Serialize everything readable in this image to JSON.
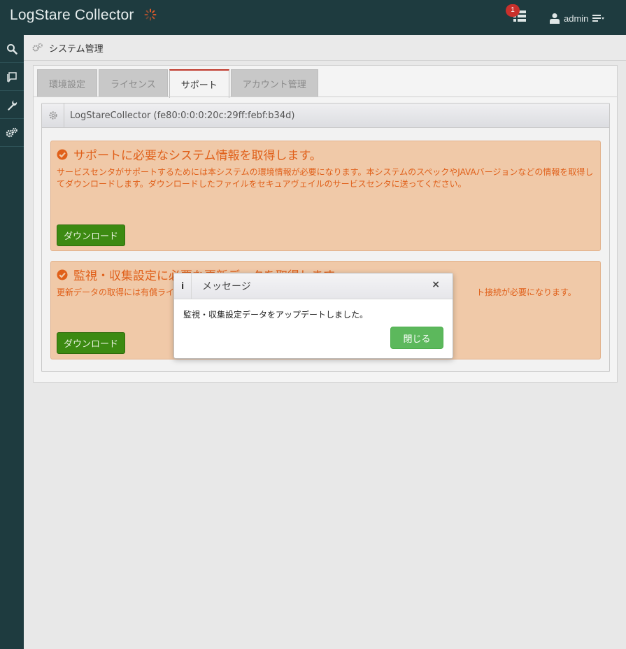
{
  "header": {
    "app_title": "LogStare Collector",
    "task_count": "1",
    "user_name": "admin"
  },
  "sidebar": {
    "items": [
      {
        "name": "search-icon"
      },
      {
        "name": "book-icon"
      },
      {
        "name": "wrench-icon"
      },
      {
        "name": "gears-icon"
      }
    ]
  },
  "breadcrumb": {
    "label": "システム管理"
  },
  "tabs": [
    {
      "label": "環境設定",
      "active": false
    },
    {
      "label": "ライセンス",
      "active": false
    },
    {
      "label": "サポート",
      "active": true
    },
    {
      "label": "アカウント管理",
      "active": false
    }
  ],
  "panel": {
    "title": "LogStareCollector (fe80:0:0:0:20c:29ff:febf:b34d)"
  },
  "support_boxes": [
    {
      "heading": "サポートに必要なシステム情報を取得します。",
      "description": "サービスセンタがサポートするためには本システムの環境情報が必要になります。本システムのスペックやJAVAバージョンなどの情報を取得してダウンロードします。ダウンロードしたファイルをセキュアヴェイルのサービスセンタに送ってください。",
      "button_label": "ダウンロード"
    },
    {
      "heading": "監視・収集設定に必要な更新データを取得します",
      "description": "更新データの取得には有償ライ　　　　　　　　　　　　　　　　　　　　　　　　　　　　　　　　　　　　ト接続が必要になります。",
      "button_label": "ダウンロード"
    }
  ],
  "dialog": {
    "info_glyph": "i",
    "title": "メッセージ",
    "close_x": "×",
    "message": "監視・収集設定データをアップデートしました。",
    "close_label": "閉じる"
  },
  "colors": {
    "header_bg": "#1e3b3f",
    "box_bg": "#f0c9a8",
    "box_text": "#e0601a",
    "download_btn": "#3c8a12",
    "close_btn": "#5cb85c",
    "active_tab_accent": "#c0392b"
  }
}
